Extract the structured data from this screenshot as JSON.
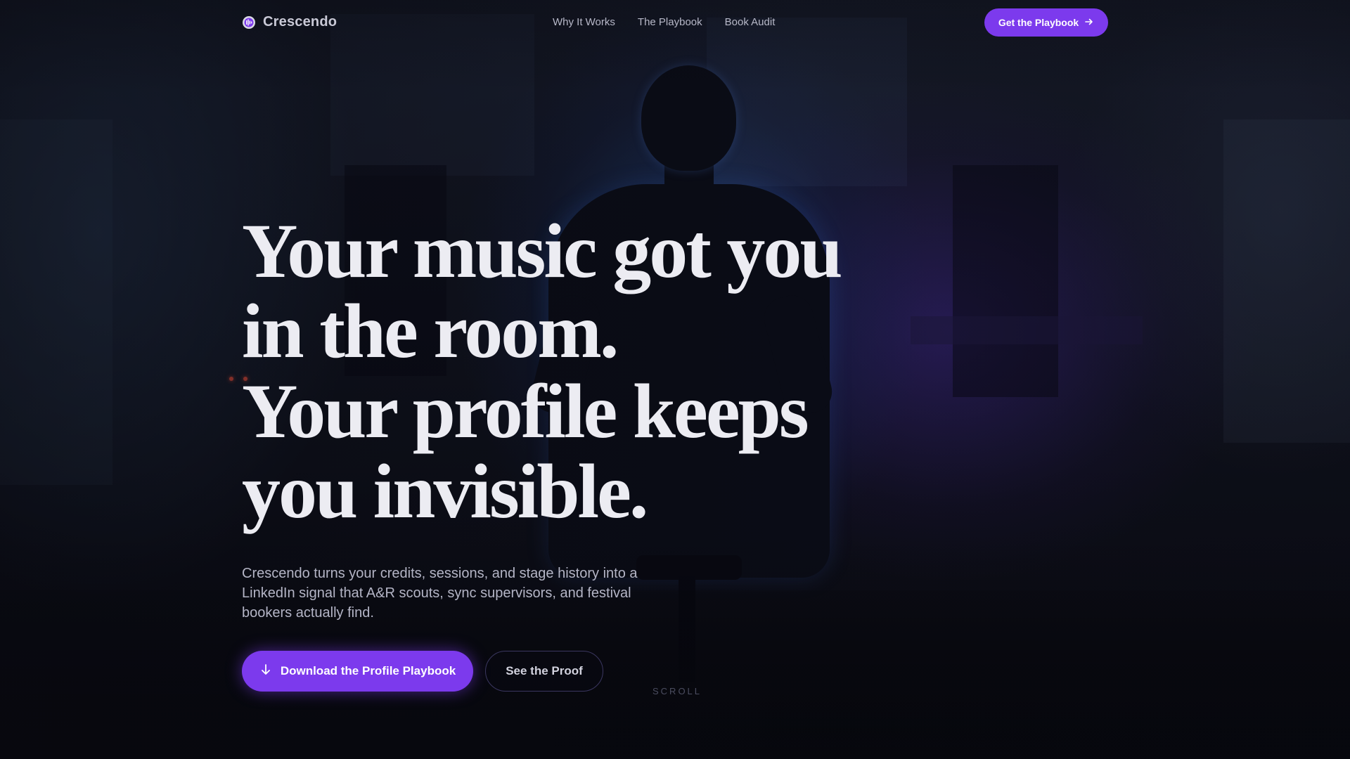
{
  "brand": {
    "name": "Crescendo",
    "icon": "crescendo-logo-icon"
  },
  "nav": {
    "items": [
      {
        "label": "Why It Works"
      },
      {
        "label": "The Playbook"
      },
      {
        "label": "Book Audit"
      }
    ],
    "cta_label": "Get the Playbook",
    "cta_icon": "arrow-right-icon"
  },
  "hero": {
    "headline_lines": [
      "Your music got you",
      "in the room.",
      "Your profile keeps",
      "you invisible."
    ],
    "subtext": "Crescendo turns your credits, sessions, and stage history into a LinkedIn signal that A&R scouts, sync supervisors, and festival bookers actually find.",
    "primary_cta": {
      "label": "Download the Profile Playbook",
      "icon": "arrow-down-icon"
    },
    "secondary_cta": {
      "label": "See the Proof"
    },
    "scroll_hint": "SCROLL"
  },
  "colors": {
    "accent": "#7c3aed",
    "background": "#0b0c14",
    "headline": "#ececf2",
    "muted_text": "#b4b5c6"
  }
}
